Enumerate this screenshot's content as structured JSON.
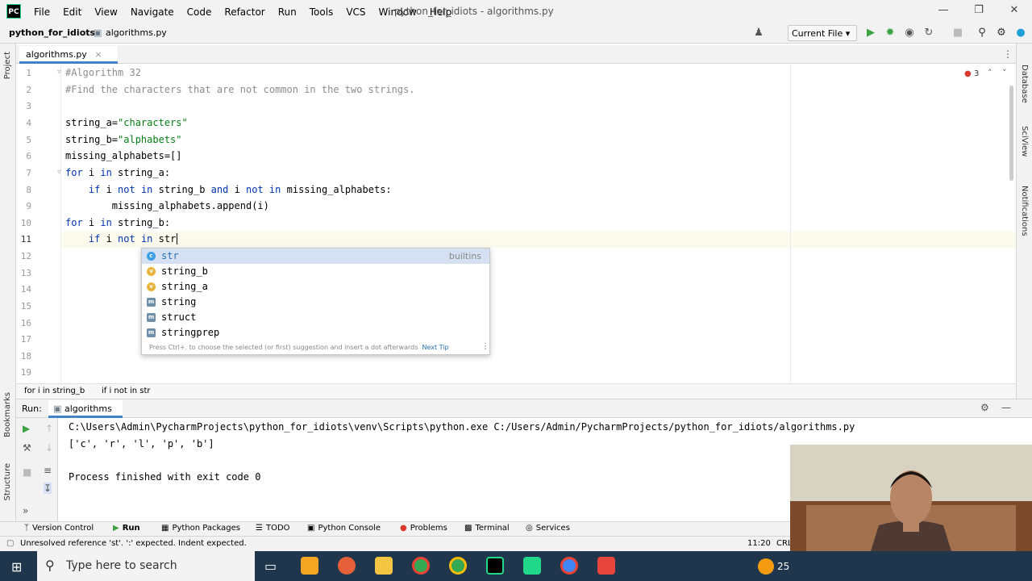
{
  "titlebar": {
    "logo": "PC",
    "menu": [
      "File",
      "Edit",
      "View",
      "Navigate",
      "Code",
      "Refactor",
      "Run",
      "Tools",
      "VCS",
      "Window",
      "Help"
    ],
    "title": "python_for_idiots - algorithms.py"
  },
  "navbar": {
    "project": "python_for_idiots",
    "file": "algorithms.py",
    "run_config": "Current File"
  },
  "left_tool_labels": [
    "Project",
    "Bookmarks",
    "Structure"
  ],
  "right_tool_labels": [
    "Database",
    "SciView",
    "Notifications"
  ],
  "editor": {
    "tab_label": "algorithms.py",
    "error_count": "3",
    "lines": [
      "1",
      "2",
      "3",
      "4",
      "5",
      "6",
      "7",
      "8",
      "9",
      "10",
      "11",
      "12",
      "13",
      "14",
      "15",
      "16",
      "17",
      "18",
      "19"
    ],
    "code": {
      "l1": "#Algorithm 32",
      "l2": "#Find the characters that are not common in the two strings.",
      "l4a": "string_a=",
      "l4b": "\"characters\"",
      "l5a": "string_b=",
      "l5b": "\"alphabets\"",
      "l6": "missing_alphabets=[]",
      "l7a": "for",
      "l7b": " i ",
      "l7c": "in",
      "l7d": " string_a:",
      "l8a": "    if",
      "l8b": " i ",
      "l8c": "not in",
      "l8d": " string_b ",
      "l8e": "and",
      "l8f": " i ",
      "l8g": "not in",
      "l8h": " missing_alphabets:",
      "l9": "        missing_alphabets.append(i)",
      "l10a": "for",
      "l10b": " i ",
      "l10c": "in",
      "l10d": " string_b:",
      "l11a": "    if",
      "l11b": " i ",
      "l11c": "not in",
      "l11d": " str"
    },
    "breadcrumb": [
      "for i in string_b",
      "if i not in str"
    ]
  },
  "autocomplete": {
    "items": [
      {
        "label": "str",
        "kind": "c",
        "source": "builtins"
      },
      {
        "label": "string_b",
        "kind": "v",
        "source": ""
      },
      {
        "label": "string_a",
        "kind": "v",
        "source": ""
      },
      {
        "label": "string",
        "kind": "m",
        "source": ""
      },
      {
        "label": "struct",
        "kind": "m",
        "source": ""
      },
      {
        "label": "stringprep",
        "kind": "m",
        "source": ""
      }
    ],
    "hint": "Press Ctrl+. to choose the selected (or first) suggestion and insert a dot afterwards",
    "next_tip": "Next Tip"
  },
  "run_panel": {
    "label": "Run:",
    "tab": "algorithms",
    "output": [
      "C:\\Users\\Admin\\PycharmProjects\\python_for_idiots\\venv\\Scripts\\python.exe C:/Users/Admin/PycharmProjects/python_for_idiots/algorithms.py",
      "['c', 'r', 'l', 'p', 'b']",
      "",
      "Process finished with exit code 0"
    ]
  },
  "tool_windows": [
    "Version Control",
    "Run",
    "Python Packages",
    "TODO",
    "Python Console",
    "Problems",
    "Terminal",
    "Services"
  ],
  "status": {
    "message": "Unresolved reference 'st'. ':' expected. Indent expected.",
    "position": "11:20",
    "line_sep": "CRL"
  },
  "taskbar": {
    "search_placeholder": "Type here to search",
    "tray_text": "25"
  },
  "colors": {
    "keyword": "#0033b3",
    "string": "#067d17",
    "comment": "#8c8c8c",
    "accent": "#4083c9",
    "taskbar": "#20364d"
  }
}
